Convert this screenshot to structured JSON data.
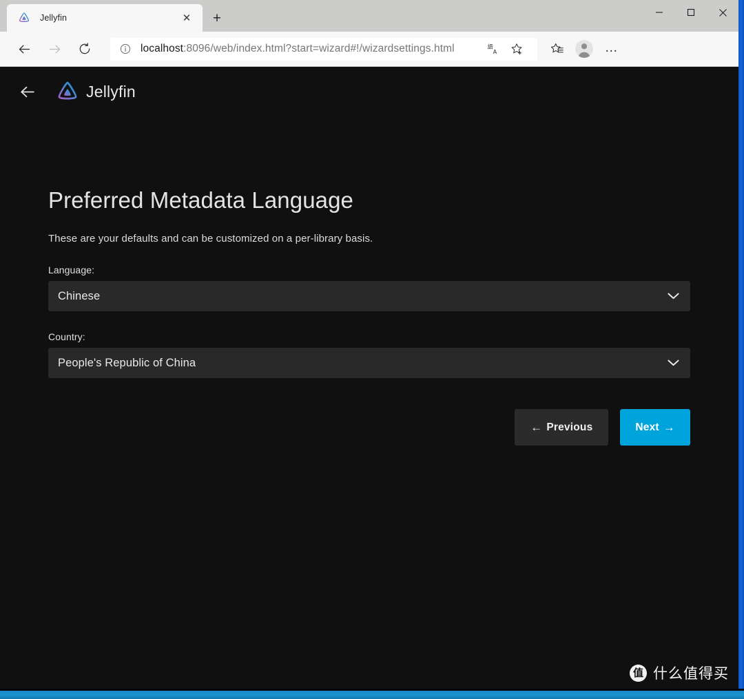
{
  "browser": {
    "tab": {
      "title": "Jellyfin",
      "favicon_icon": "jellyfin-logo-icon",
      "close_icon": "close-icon",
      "close_glyph": "✕"
    },
    "new_tab_icon": "plus-icon",
    "new_tab_glyph": "+",
    "window_controls": {
      "minimize_icon": "minimize-icon",
      "maximize_icon": "maximize-icon",
      "close_icon": "window-close-icon"
    },
    "nav": {
      "back_icon": "back-arrow-icon",
      "forward_icon": "forward-arrow-icon",
      "refresh_icon": "refresh-icon"
    },
    "address_bar": {
      "info_icon": "site-info-icon",
      "host": "localhost",
      "path": ":8096/web/index.html?start=wizard#!/wizardsettings.html",
      "full_url": "localhost:8096/web/index.html?start=wizard#!/wizardsettings.html",
      "translate_icon": "translate-icon",
      "favorite_icon": "star-add-icon"
    },
    "toolbar": {
      "favorites_icon": "favorites-list-icon",
      "profile_icon": "profile-avatar-icon",
      "settings_icon": "more-options-icon",
      "settings_glyph": "…"
    }
  },
  "app": {
    "back_icon": "app-back-arrow-icon",
    "logo_icon": "jellyfin-logo-icon",
    "name": "Jellyfin"
  },
  "wizard": {
    "title": "Preferred Metadata Language",
    "description": "These are your defaults and can be customized on a per-library basis.",
    "fields": [
      {
        "label": "Language:",
        "value": "Chinese",
        "chevron_icon": "chevron-down-icon",
        "name": "language"
      },
      {
        "label": "Country:",
        "value": "People's Republic of China",
        "chevron_icon": "chevron-down-icon",
        "name": "country"
      }
    ],
    "buttons": {
      "previous": {
        "label": "Previous",
        "arrow": "←",
        "icon": "left-arrow-icon"
      },
      "next": {
        "label": "Next",
        "arrow": "→",
        "icon": "right-arrow-icon"
      }
    }
  },
  "watermark": {
    "badge": "值",
    "text": "什么值得买"
  },
  "colors": {
    "accent": "#00a4dc",
    "page_background": "#101010",
    "field_background": "#292929",
    "chrome_background": "#f7f7f7",
    "frame_blue": "#1565d8",
    "frame_bottom_blue": "#1b93cf"
  }
}
